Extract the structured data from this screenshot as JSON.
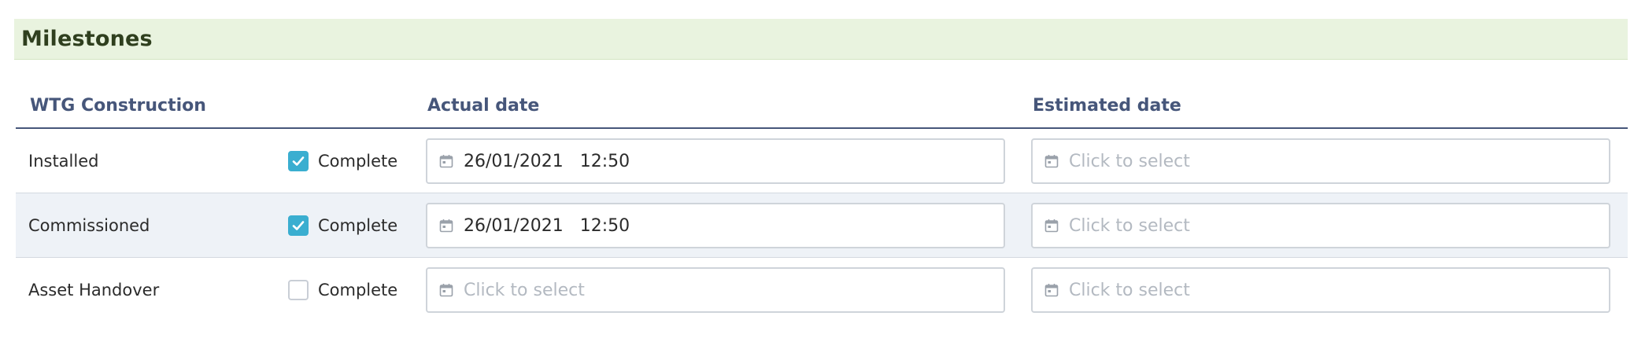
{
  "section": {
    "title": "Milestones"
  },
  "table": {
    "headers": {
      "group": "WTG Construction",
      "actual": "Actual date",
      "estimated": "Estimated date"
    },
    "rows": [
      {
        "label": "Installed",
        "complete": true,
        "complete_label": "Complete",
        "actual": "26/01/2021   12:50",
        "estimated": "Click to select"
      },
      {
        "label": "Commissioned",
        "complete": true,
        "complete_label": "Complete",
        "actual": "26/01/2021   12:50",
        "estimated": "Click to select"
      },
      {
        "label": "Asset Handover",
        "complete": false,
        "complete_label": "Complete",
        "actual": "Click to select",
        "estimated": "Click to select"
      }
    ]
  },
  "colors": {
    "checkbox_checked": "#3aaed0",
    "header_bg": "#e9f3df",
    "column_header": "#46567a"
  },
  "icons": {
    "date_field": "calendar-icon",
    "checkbox": "checkmark-icon"
  }
}
